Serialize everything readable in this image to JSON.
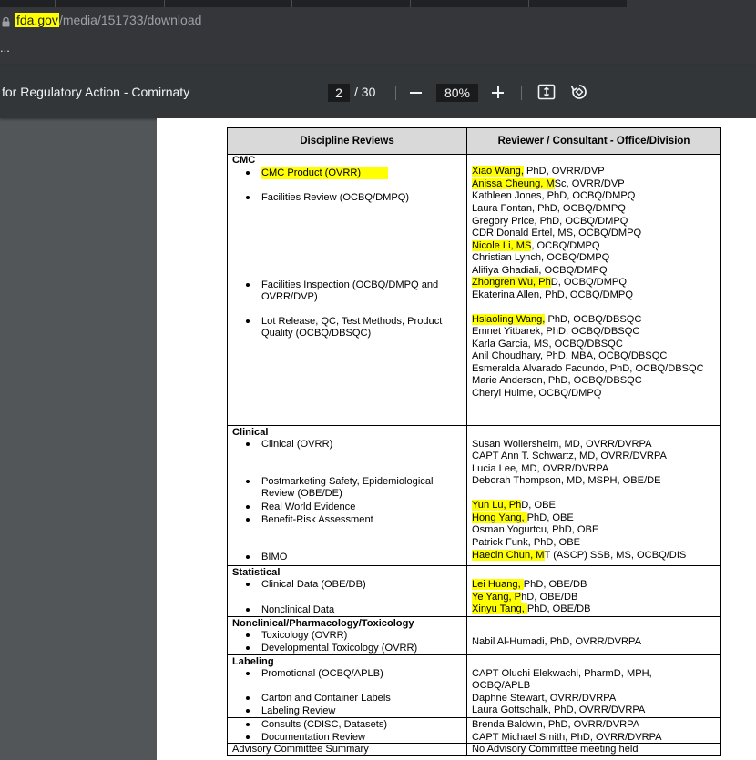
{
  "browser": {
    "url_host": "fda.gov",
    "url_path": "/media/151733/download",
    "bookmarks_overflow": "..."
  },
  "viewer": {
    "doc_title": "for Regulatory Action - Comirnaty",
    "page_current": "2",
    "page_total": "/ 30",
    "zoom": "80%"
  },
  "icons": [
    "lock-icon",
    "zoom-out-icon",
    "zoom-in-icon",
    "fit-page-icon",
    "rotate-icon"
  ],
  "highlight_color": "#ffff00",
  "table": {
    "header_left": "Discipline Reviews",
    "header_right": "Reviewer / Consultant - Office/Division",
    "sections": [
      {
        "title": "CMC",
        "left": [
          {
            "text": "CMC Product (OVRR)",
            "hl": true
          },
          {
            "text": "Facilities Review (OCBQ/DMPQ)"
          },
          {
            "text": "Facilities Inspection (OCBQ/DMPQ and"
          },
          {
            "text": "OVRR/DVP)"
          },
          {
            "text": "Lot Release, QC, Test Methods, Product"
          },
          {
            "text": "Quality (OCBQ/DBSQC)"
          }
        ],
        "right": [
          {
            "hl": "Xiao Wang,",
            "rest": " PhD, OVRR/DVP"
          },
          {
            "hl": "Anissa Cheung, M",
            "rest": "Sc, OVRR/DVP"
          },
          {
            "rest": "Kathleen Jones, PhD, OCBQ/DMPQ"
          },
          {
            "rest": "Laura Fontan, PhD, OCBQ/DMPQ"
          },
          {
            "rest": "Gregory Price, PhD, OCBQ/DMPQ"
          },
          {
            "rest": "CDR Donald Ertel, MS, OCBQ/DMPQ"
          },
          {
            "hl": "Nicole Li, MS",
            "rest": ", OCBQ/DMPQ"
          },
          {
            "rest": "Christian Lynch, OCBQ/DMPQ"
          },
          {
            "rest": "Alifiya Ghadiali, OCBQ/DMPQ"
          },
          {
            "hl": "Zhongren Wu, Ph",
            "rest": "D, OCBQ/DMPQ"
          },
          {
            "rest": "Ekaterina Allen, PhD, OCBQ/DMPQ"
          },
          {
            "hl": "Hsiaoling Wang,",
            "rest": " PhD, OCBQ/DBSQC"
          },
          {
            "rest": "Emnet Yitbarek, PhD, OCBQ/DBSQC"
          },
          {
            "rest": "Karla Garcia, MS, OCBQ/DBSQC"
          },
          {
            "rest": "Anil Choudhary, PhD, MBA, OCBQ/DBSQC"
          },
          {
            "rest": "Esmeralda Alvarado Facundo, PhD, OCBQ/DBSQC"
          },
          {
            "rest": "Marie Anderson, PhD, OCBQ/DBSQC"
          },
          {
            "rest": "Cheryl Hulme, OCBQ/DMPQ"
          }
        ]
      },
      {
        "title": "Clinical",
        "left": [
          {
            "text": "Clinical (OVRR)"
          },
          {
            "text": "Postmarketing Safety, Epidemiological"
          },
          {
            "text": "Review (OBE/DE)"
          },
          {
            "text": "Real World Evidence"
          },
          {
            "text": "Benefit-Risk Assessment"
          },
          {
            "text": "BIMO"
          }
        ],
        "right": [
          {
            "rest": "Susan Wollersheim, MD, OVRR/DVRPA"
          },
          {
            "rest": "CAPT Ann T. Schwartz, MD, OVRR/DVRPA"
          },
          {
            "rest": "Lucia Lee, MD, OVRR/DVRPA"
          },
          {
            "rest": "Deborah Thompson, MD, MSPH, OBE/DE"
          },
          {
            "hl": "Yun Lu, Ph",
            "rest": "D, OBE"
          },
          {
            "hl": "Hong Yang, ",
            "rest": "PhD, OBE"
          },
          {
            "rest": "Osman Yogurtcu, PhD, OBE"
          },
          {
            "rest": "Patrick Funk, PhD, OBE"
          },
          {
            "hl": "Haecin Chun, M",
            "rest": "T (ASCP) SSB, MS, OCBQ/DIS"
          }
        ]
      },
      {
        "title": "Statistical",
        "left": [
          {
            "text": "Clinical Data (OBE/DB)"
          },
          {
            "text": "Nonclinical Data"
          }
        ],
        "right": [
          {
            "hl": "Lei Huang, ",
            "rest": "PhD, OBE/DB"
          },
          {
            "hl": "Ye Yang, P",
            "rest": "hD, OBE/DB"
          },
          {
            "hl": "Xinyu Tang, ",
            "rest": "PhD, OBE/DB"
          }
        ]
      },
      {
        "title": "Nonclinical/Pharmacology/Toxicology",
        "left": [
          {
            "text": "Toxicology (OVRR)"
          },
          {
            "text": "Developmental Toxicology (OVRR)"
          }
        ],
        "right": [
          {
            "rest": "Nabil Al-Humadi, PhD, OVRR/DVRPA"
          }
        ]
      },
      {
        "title": "Labeling",
        "left": [
          {
            "text": "Promotional (OCBQ/APLB)"
          },
          {
            "text": "Carton and Container Labels"
          },
          {
            "text": "Labeling Review"
          }
        ],
        "right": [
          {
            "rest": "CAPT Oluchi Elekwachi, PharmD, MPH,"
          },
          {
            "rest": "OCBQ/APLB"
          },
          {
            "rest": "Daphne Stewart, OVRR/DVRPA"
          },
          {
            "rest": "Laura Gottschalk, PhD, OVRR/DVRPA"
          }
        ]
      },
      {
        "title": "",
        "left": [
          {
            "text": "Consults (CDISC, Datasets)"
          },
          {
            "text": "Documentation Review"
          }
        ],
        "right": [
          {
            "rest": "Brenda Baldwin, PhD, OVRR/DVRPA"
          },
          {
            "rest": "CAPT Michael Smith, PhD, OVRR/DVRPA"
          }
        ]
      },
      {
        "title": "",
        "left": [
          {
            "text": "Advisory Committee Summary"
          }
        ],
        "right": [
          {
            "rest": "No Advisory Committee meeting held"
          }
        ]
      }
    ]
  }
}
